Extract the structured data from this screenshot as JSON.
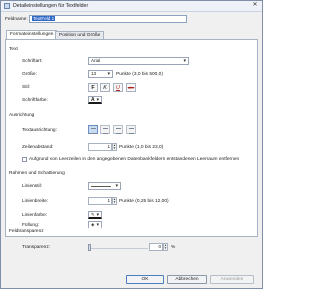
{
  "window": {
    "title": "Detaileinstellungen für Textfelder",
    "close_glyph": "✕"
  },
  "fieldname": {
    "label": "Feldname:",
    "value": "TextFeld 1"
  },
  "tabs": [
    {
      "label": "Formateinstellungen",
      "active": true
    },
    {
      "label": "Position und Größe",
      "active": false
    }
  ],
  "text_section": {
    "title": "Text",
    "font_label": "Schriftart:",
    "font_value": "Arial",
    "size_label": "Größe:",
    "size_value": "13",
    "size_hint": "Punkte (3,0 bis 500,0)",
    "style_label": "Stil:",
    "style_buttons": [
      "F",
      "K",
      "U",
      "abc"
    ],
    "color_label": "Schriftfarbe:",
    "color_glyph": "A"
  },
  "alignment_section": {
    "title": "Ausrichtung",
    "direction_label": "Textausrichtung:",
    "spacing_label": "Zeilenabstand:",
    "spacing_value": "1",
    "spacing_hint": "Punkte (1,0 bis 23,0)",
    "checkbox_label": "Aufgrund von Leerzeilen in den angegebenen Datenbankfeldern entstandenen Leerraum entfernen",
    "checkbox_checked": false
  },
  "frame_section": {
    "title": "Rahmen und Schattierung",
    "linestyle_label": "Linienstil:",
    "linewidth_label": "Linienbreite:",
    "linewidth_value": "1",
    "linewidth_hint": "Punkte (0,25 bis 12,00)",
    "linecolor_label": "Linienfarbe:",
    "fill_label": "Füllung:"
  },
  "transparency_section": {
    "title": "Feldtransparenz",
    "label": "Transparenz:",
    "value": "0",
    "unit": "%"
  },
  "footer": {
    "ok": "OK",
    "cancel": "Abbrechen",
    "apply": "Anwenden"
  },
  "colors": {
    "selection": "#3169c6",
    "active_toggle": "#c7dbf3",
    "window_border": "#7f8fa8"
  }
}
